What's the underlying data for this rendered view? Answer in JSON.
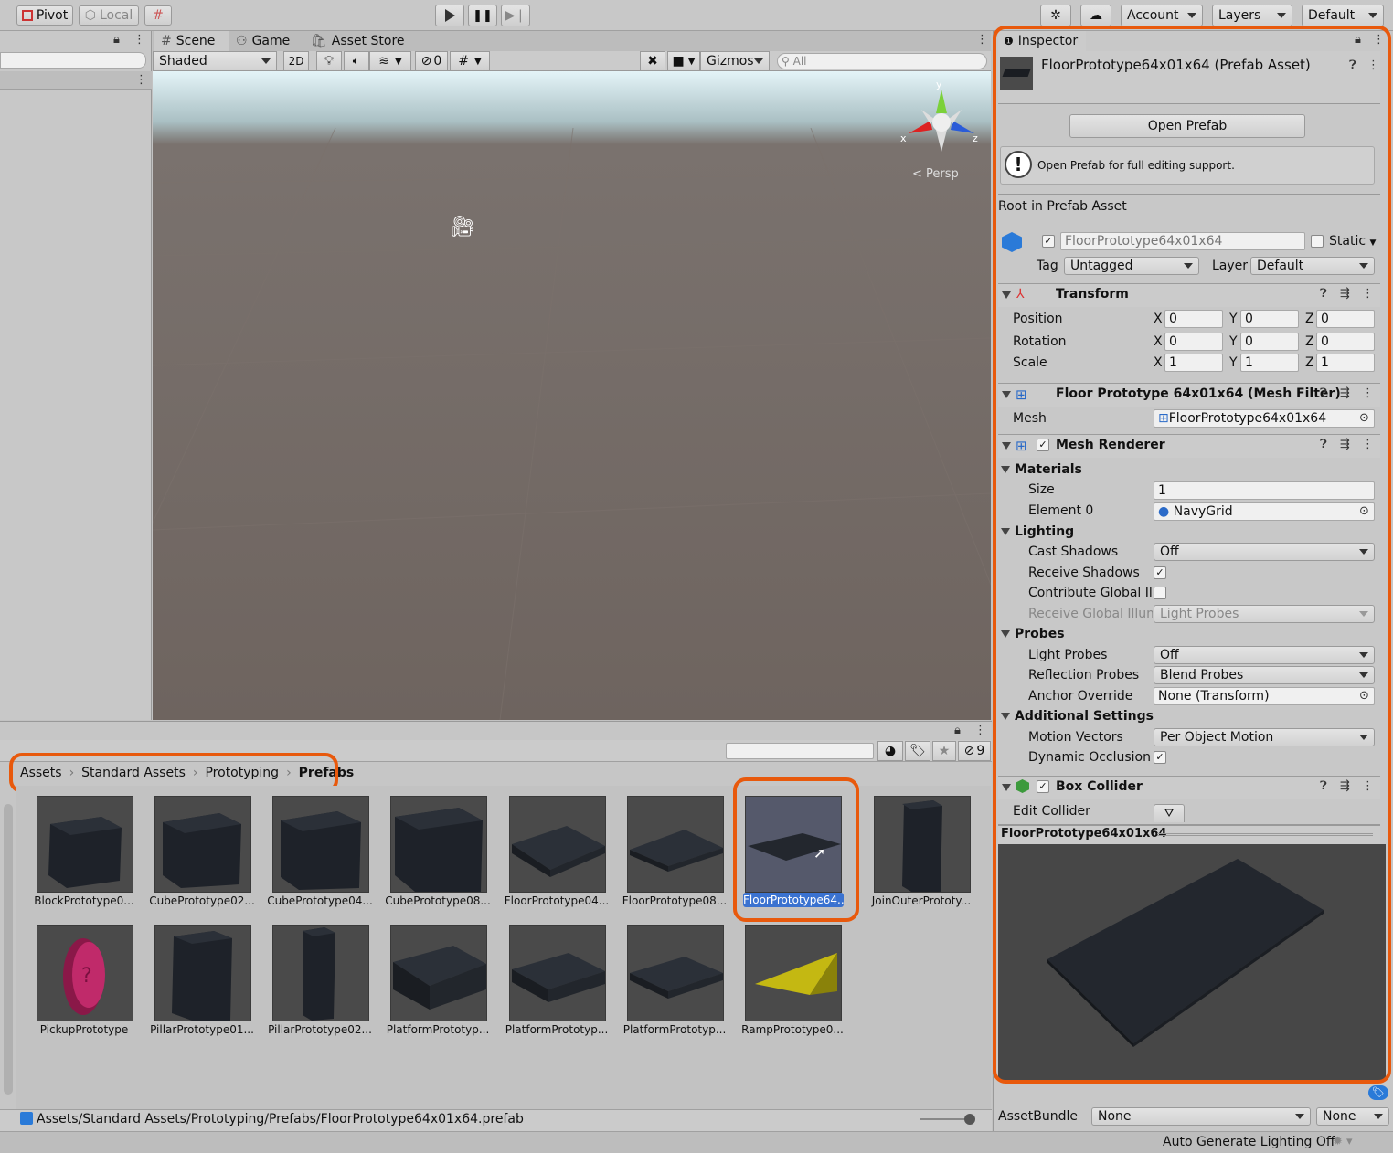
{
  "toolbar": {
    "pivot": "Pivot",
    "local": "Local",
    "account": "Account",
    "layers": "Layers",
    "layout": "Default"
  },
  "scene": {
    "tabs": [
      "Scene",
      "Game",
      "Asset Store"
    ],
    "shading": "Shaded",
    "mode2d": "2D",
    "hidden_count": "0",
    "gizmos": "Gizmos",
    "search_placeholder": "All",
    "persp": "Persp",
    "axis_x": "x",
    "axis_y": "y",
    "axis_z": "z"
  },
  "project": {
    "breadcrumb": [
      "Assets",
      "Standard Assets",
      "Prototyping",
      "Prefabs"
    ],
    "hidden_count": "9",
    "assets_row1": [
      "BlockPrototype0...",
      "CubePrototype02...",
      "CubePrototype04...",
      "CubePrototype08...",
      "FloorPrototype04...",
      "FloorPrototype08...",
      "FloorPrototype64...",
      "JoinOuterPrototy..."
    ],
    "assets_row2": [
      "PickupPrototype",
      "PillarPrototype01...",
      "PillarPrototype02...",
      "PlatformPrototyp...",
      "PlatformPrototyp...",
      "PlatformPrototyp...",
      "RampPrototype0..."
    ],
    "status_path": "Assets/Standard Assets/Prototyping/Prefabs/FloorPrototype64x01x64.prefab"
  },
  "inspector": {
    "tab": "Inspector",
    "title": "FloorPrototype64x01x64 (Prefab Asset)",
    "open_prefab": "Open Prefab",
    "info": "Open Prefab for full editing support.",
    "root_label": "Root in Prefab Asset",
    "object_name": "FloorPrototype64x01x64",
    "static": "Static",
    "tag_label": "Tag",
    "tag": "Untagged",
    "layer_label": "Layer",
    "layer": "Default",
    "transform": {
      "title": "Transform",
      "rows": [
        {
          "label": "Position",
          "x": "0",
          "y": "0",
          "z": "0"
        },
        {
          "label": "Rotation",
          "x": "0",
          "y": "0",
          "z": "0"
        },
        {
          "label": "Scale",
          "x": "1",
          "y": "1",
          "z": "1"
        }
      ]
    },
    "mesh_filter": {
      "title": "Floor Prototype 64x01x64 (Mesh Filter)",
      "mesh_label": "Mesh",
      "mesh": "FloorPrototype64x01x64"
    },
    "mesh_renderer": {
      "title": "Mesh Renderer",
      "materials": "Materials",
      "size_label": "Size",
      "size": "1",
      "element_label": "Element 0",
      "element": "NavyGrid",
      "lighting": "Lighting",
      "cast_label": "Cast Shadows",
      "cast": "Off",
      "receive_label": "Receive Shadows",
      "contribute_label": "Contribute Global Illui",
      "receive_gi_label": "Receive Global Illumi",
      "receive_gi": "Light Probes",
      "probes": "Probes",
      "light_probes_label": "Light Probes",
      "light_probes": "Off",
      "reflection_label": "Reflection Probes",
      "reflection": "Blend Probes",
      "anchor_label": "Anchor Override",
      "anchor": "None (Transform)",
      "additional": "Additional Settings",
      "motion_label": "Motion Vectors",
      "motion": "Per Object Motion",
      "occlusion_label": "Dynamic Occlusion"
    },
    "box_collider": {
      "title": "Box Collider",
      "edit_label": "Edit Collider"
    },
    "preview_title": "FloorPrototype64x01x64",
    "assetbundle_label": "AssetBundle",
    "assetbundle": "None",
    "assetbundle_variant": "None"
  },
  "statusbar": {
    "lighting": "Auto Generate Lighting Off"
  },
  "colors": {
    "highlight": "#e8590c",
    "selection": "#3a72d0"
  }
}
